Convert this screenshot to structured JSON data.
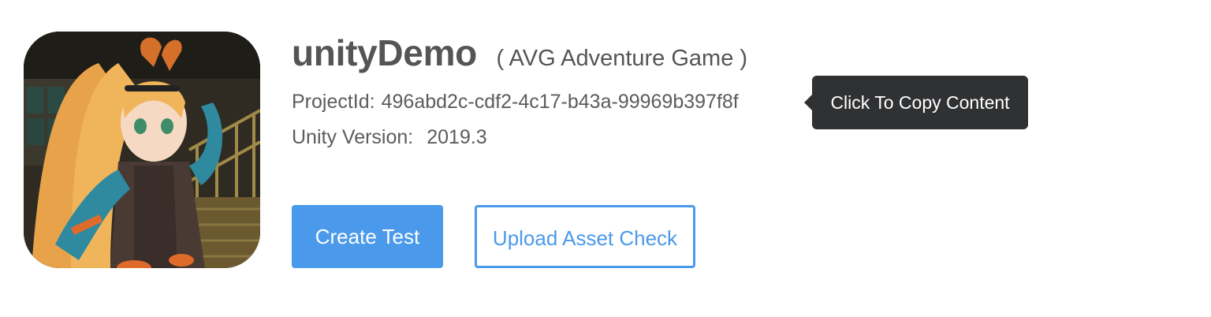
{
  "project": {
    "title": "unityDemo",
    "category": "( AVG Adventure Game )",
    "project_id_label": "ProjectId:",
    "project_id": "496abd2c-cdf2-4c17-b43a-99969b397f8f",
    "unity_version_label": "Unity Version:",
    "unity_version": "2019.3"
  },
  "tooltip": {
    "text": "Click To Copy Content"
  },
  "actions": {
    "create_test": "Create Test",
    "upload_asset_check": "Upload Asset Check"
  },
  "colors": {
    "primary": "#4a99ea",
    "text": "#555555",
    "tooltip_bg": "#303133"
  }
}
